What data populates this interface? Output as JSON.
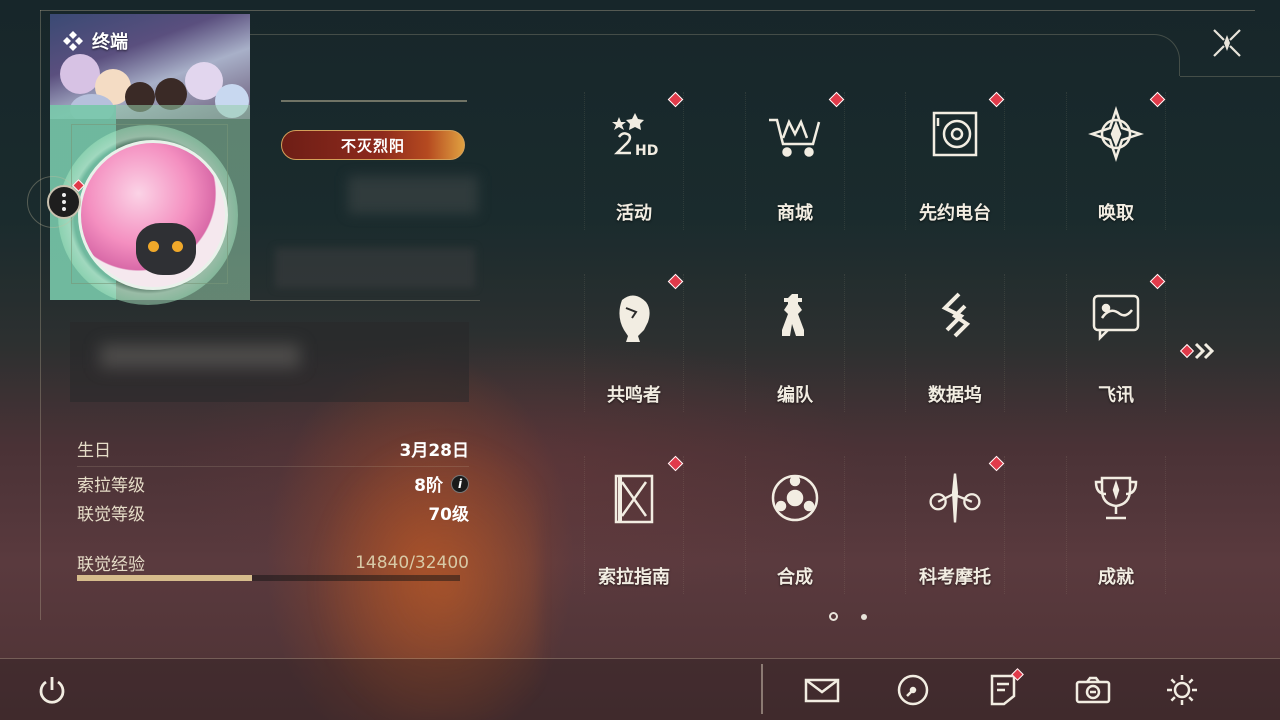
{
  "header": {
    "title": "终端",
    "close_icon": "close-x-icon"
  },
  "profile": {
    "title_badge": "不灭烈阳",
    "avatar": "player-avatar",
    "more_icon": "more-vertical-icon",
    "info": [
      {
        "key": "生日",
        "value": "3月28日"
      },
      {
        "key": "索拉等级",
        "value": "8阶"
      },
      {
        "key": "联觉等级",
        "value": "70级"
      }
    ],
    "exp": {
      "key": "联觉经验",
      "value": "14840/32400",
      "progress": 0.458
    }
  },
  "menu": [
    {
      "label": "活动",
      "icon": "event-2hd-icon",
      "badge": true
    },
    {
      "label": "商城",
      "icon": "shop-cart-icon",
      "badge": true
    },
    {
      "label": "先约电台",
      "icon": "radio-speaker-icon",
      "badge": true
    },
    {
      "label": "唤取",
      "icon": "convene-star-icon",
      "badge": true
    },
    {
      "label": "共鸣者",
      "icon": "resonator-portrait-icon",
      "badge": true
    },
    {
      "label": "编队",
      "icon": "team-chess-icon",
      "badge": false
    },
    {
      "label": "数据坞",
      "icon": "data-bank-icon",
      "badge": false
    },
    {
      "label": "飞讯",
      "icon": "chat-message-icon",
      "badge": true
    },
    {
      "label": "索拉指南",
      "icon": "guidebook-icon",
      "badge": true
    },
    {
      "label": "合成",
      "icon": "synthesis-icon",
      "badge": false
    },
    {
      "label": "科考摩托",
      "icon": "motorcycle-icon",
      "badge": true
    },
    {
      "label": "成就",
      "icon": "trophy-icon",
      "badge": false
    }
  ],
  "pager": {
    "current": 1,
    "total": 2
  },
  "bottom_bar": {
    "power": "power-icon",
    "mail": "mail-icon",
    "clock": "clock-icon",
    "notice": "notice-icon",
    "camera": "camera-icon",
    "settings": "gear-icon"
  },
  "colors": {
    "accent": "#d6bc8c",
    "badge_red": "#e03a4a",
    "text": "#f2ede2"
  }
}
